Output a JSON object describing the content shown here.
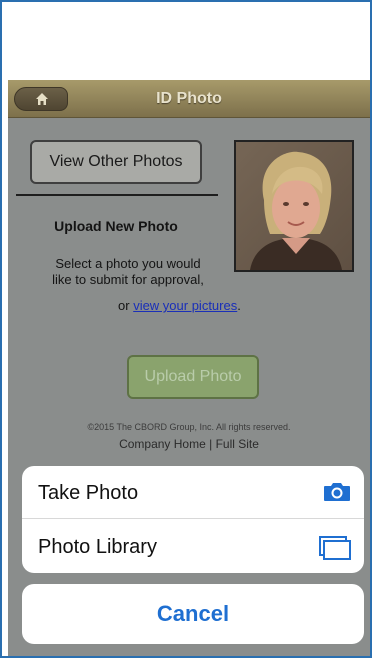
{
  "navbar": {
    "title": "ID Photo",
    "home_icon": "home-icon"
  },
  "main": {
    "view_other_label": "View Other Photos",
    "upload_heading": "Upload New Photo",
    "instructions_line1": "Select a photo you would",
    "instructions_line2": "like to submit for approval,",
    "instructions_prefix": "or",
    "instructions_link": "view your pictures",
    "instructions_suffix": ".",
    "upload_button_label": "Upload Photo"
  },
  "footer": {
    "copyright": "©2015 The CBORD Group, Inc. All rights reserved.",
    "links": "Company Home | Full Site"
  },
  "action_sheet": {
    "items": [
      {
        "label": "Take Photo",
        "icon": "camera-icon"
      },
      {
        "label": "Photo Library",
        "icon": "photo-library-icon"
      }
    ],
    "cancel_label": "Cancel"
  },
  "colors": {
    "accent": "#1f6fd1",
    "navbar": "#8f8358",
    "upload_button": "#8aa36d"
  }
}
